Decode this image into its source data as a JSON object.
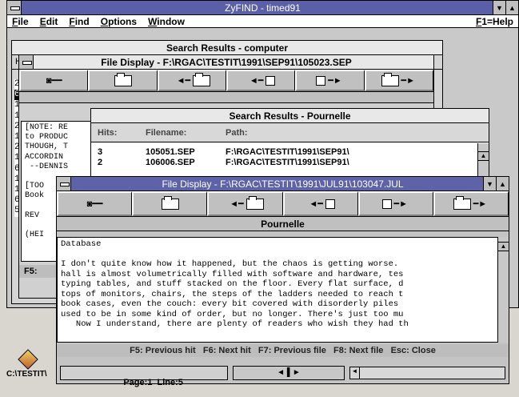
{
  "app": {
    "title": "ZyFIND - timed91",
    "help": "F1=Help",
    "menu": [
      "File",
      "Edit",
      "Find",
      "Options",
      "Window"
    ]
  },
  "search_computer": {
    "title": "Search Results - computer",
    "col_first": "H",
    "hits_col": [
      "2",
      "6",
      "1",
      "1",
      "2",
      "1",
      "2",
      "1",
      "6",
      "1",
      "1",
      "6",
      "5"
    ]
  },
  "file_display_back": {
    "title": "File Display - F:\\RGAC\\TESTIT\\1991\\SEP91\\105023.SEP",
    "text_lines": [
      "[NOTE: RE",
      "to PRODUC",
      "THOUGH, T",
      "ACCORDIN",
      " --DENNIS",
      "",
      "[TOO",
      "Book",
      "",
      "REV",
      "",
      "(HEI"
    ],
    "fkey": "F5:"
  },
  "search_pournelle": {
    "title": "Search Results - Pournelle",
    "headers": {
      "hits": "Hits:",
      "filename": "Filename:",
      "path": "Path:"
    },
    "rows": [
      {
        "hits": "3",
        "filename": "105051.SEP",
        "path": "F:\\RGAC\\TESTIT\\1991\\SEP91\\"
      },
      {
        "hits": "2",
        "filename": "106006.SEP",
        "path": "F:\\RGAC\\TESTIT\\1991\\SEP91\\"
      }
    ]
  },
  "file_display_front": {
    "title": "File Display - F:\\RGAC\\TESTIT\\1991\\JUL91\\103047.JUL",
    "banner": "Pournelle",
    "text": [
      "Database",
      "",
      "I don't quite know how it happened, but the chaos is getting worse.",
      "hall is almost volumetrically filled with software and hardware, tes",
      "typing tables, and stuff stacked on the floor. Every flat surface, d",
      "tops of monitors, chairs, the steps of the ladders needed to reach t",
      "book cases, even the couch: every bit covered with disorderly piles",
      "used to be in some kind of order, but no longer. There's just too mu",
      "   Now I understand, there are plenty of readers who wish they had th"
    ],
    "fkeys": "F5: Previous hit   F6: Next hit   F7: Previous file   F8: Next file   Esc: Close",
    "page_line": "Page:1  Line:5"
  },
  "desktop": {
    "icon_label": "C:\\TESTIT\\"
  }
}
